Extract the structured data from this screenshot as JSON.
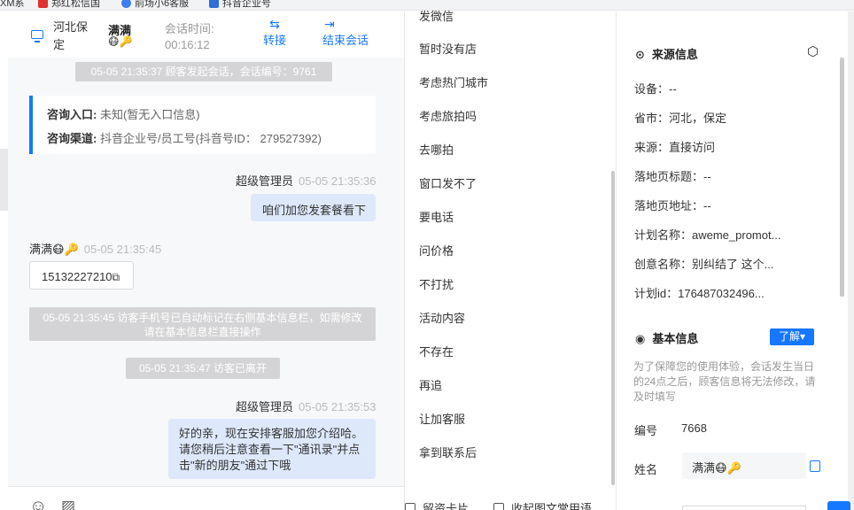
{
  "bookmarks": [
    {
      "label": "XM系",
      "color": "#555555"
    },
    {
      "label": "郑红松信国",
      "color": "#e0312f"
    },
    {
      "label": "前场小6客服",
      "color": "#3c7bf0"
    },
    {
      "label": "抖音企业号",
      "color": "#2f6fd8"
    }
  ],
  "chat_header": {
    "location": "河北保定",
    "visitor_name": "满满",
    "visitor_emoji": "😷🔑",
    "time_label": "会话时间:",
    "time_value": "00:16:12",
    "transfer_label": "转接",
    "end_label": "结束会话"
  },
  "messages": {
    "sys_start": "05-05 21:35:37 顾客发起会话，会话编号：9761",
    "entry_label": "咨询入口:",
    "entry_value": " 未知(暂无入口信息)",
    "channel_label": "咨询渠道:",
    "channel_value": " 抖音企业号/员工号(抖音号ID： 279527392)",
    "agent1_name": "超级管理员",
    "agent1_time": "05-05 21:35:36",
    "agent1_text": "咱们加您发套餐看下",
    "visitor_name": "满满😷🔑",
    "visitor_time": "05-05 21:35:45",
    "visitor_phone": "15132227210",
    "sys_phone": "05-05 21:35:45 访客手机号已自动标记在右侧基本信息栏，如需修改请在基本信息栏直接操作",
    "sys_left": "05-05 21:35:47 访客已离开",
    "agent2_name": "超级管理员",
    "agent2_time": "05-05 21:35:53",
    "agent2_text": "好的亲，现在安排客服加您介绍哈。请您稍后注意查看一下\"通讯录\"并点击\"新的朋友\"通过下哦"
  },
  "toolbar": {
    "emoji_icon": "smile-icon",
    "image_icon": "image-icon"
  },
  "quick_replies": {
    "items": [
      "发微信",
      "暂时没有店",
      "考虑热门城市",
      "考虑旅拍吗",
      "去哪拍",
      "窗口发不了",
      "要电话",
      "问价格",
      "不打扰",
      "活动内容",
      "不存在",
      "再追",
      "让加客服",
      "拿到联系后"
    ],
    "footer_card": "留资卡片",
    "footer_collapse": "收起图文常用语"
  },
  "source_info": {
    "title": "来源信息",
    "device": "设备：--",
    "province": "省市：河北，保定",
    "source": "来源：直接访问",
    "landing_title": "落地页标题：--",
    "landing_url": "落地页地址：--",
    "plan_name": "计划名称：aweme_promot...",
    "creative_name": "创意名称：别纠结了 这个...",
    "plan_id": "计划id：176487032496..."
  },
  "basic_info": {
    "title": "基本信息",
    "badge": "了解▾",
    "note": "为了保障您的使用体验，会话发生当日的24点之后，顾客信息将无法修改，请及时填写",
    "id_label": "编号",
    "id_value": "7668",
    "name_label": "姓名",
    "name_value": "满满😷🔑"
  },
  "colors": {
    "accent": "#1677ff",
    "system_msg_bg": "#d4d4d6",
    "agent_bubble": "#dde9fb"
  }
}
